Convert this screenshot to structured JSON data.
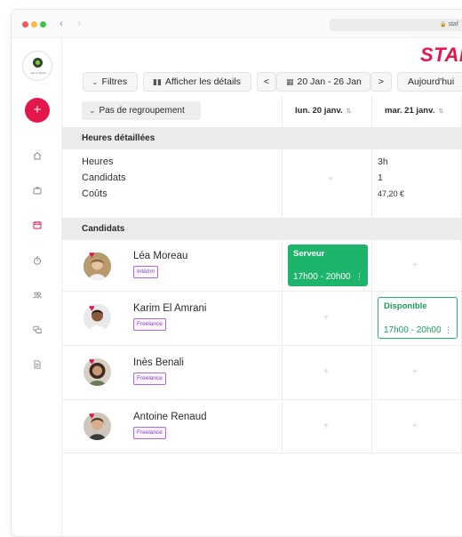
{
  "browser": {
    "url": "staf"
  },
  "brand": {
    "name": "STAF",
    "color": "#e3174c"
  },
  "sidebar": {
    "logo_text": "café et bistrot",
    "add_label": "+",
    "icons": [
      "home-icon",
      "briefcase-icon",
      "calendar-icon",
      "timer-icon",
      "users-icon",
      "chat-icon",
      "document-icon"
    ]
  },
  "toolbar": {
    "filters_label": "Filtres",
    "details_label": "Afficher les détails",
    "date_range_label": "20 Jan - 26 Jan",
    "today_label": "Aujourd'hui",
    "prev_label": "<",
    "next_label": ">"
  },
  "grid": {
    "group_label": "Pas de regroupement",
    "days": [
      "lun. 20 janv.",
      "mar. 21 janv."
    ],
    "section_hours": "Heures détaillées",
    "section_candidates": "Candidats",
    "hours_labels": [
      "Heures",
      "Candidats",
      "Coûts"
    ],
    "day2_hours_values": [
      "3h",
      "1",
      "47,20 €"
    ],
    "candidates": [
      {
        "name": "Léa Moreau",
        "badge": "Intérim"
      },
      {
        "name": "Karim El Amrani",
        "badge": "Freelance"
      },
      {
        "name": "Inès Benali",
        "badge": "Freelance"
      },
      {
        "name": "Antoine Renaud",
        "badge": "Freelance"
      }
    ],
    "shifts": [
      {
        "title": "Serveur",
        "time": "17h00 - 20h00",
        "style": "filled",
        "color": "#1db56b"
      },
      {
        "title": "Disponible",
        "time": "17h00 - 20h00",
        "style": "outline",
        "color": "#1db56b"
      }
    ]
  }
}
